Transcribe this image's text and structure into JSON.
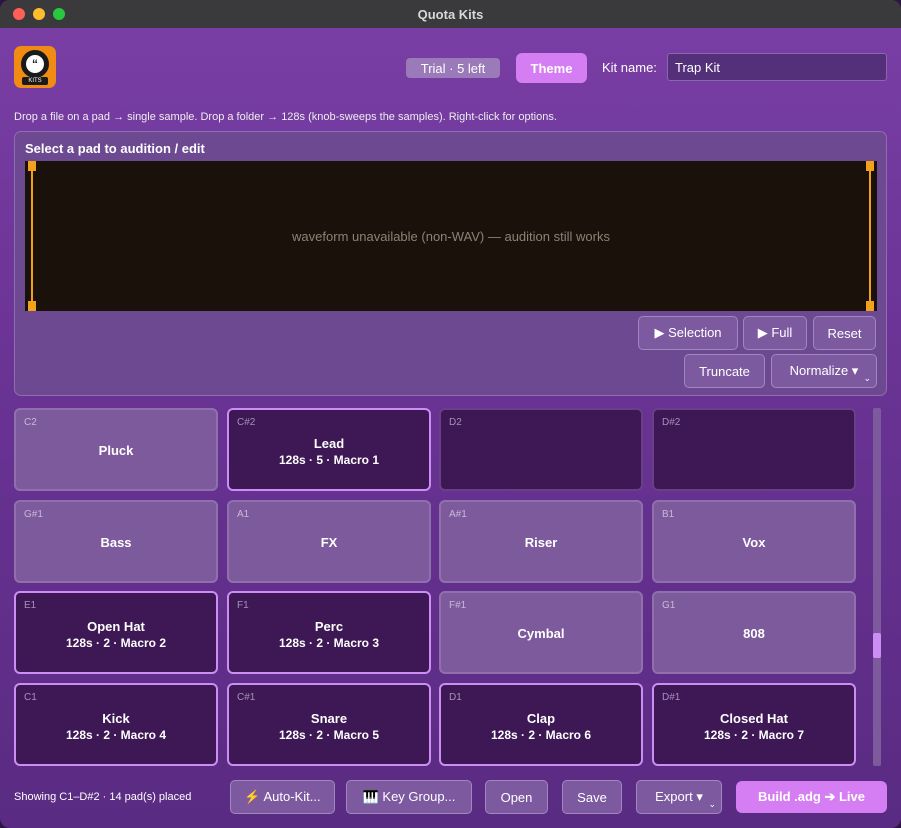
{
  "window": {
    "title": "Quota Kits"
  },
  "header": {
    "logo_text": "KITS",
    "trial_label": "Trial · 5 left",
    "theme_label": "Theme",
    "kit_name_label": "Kit name:",
    "kit_name_value": "Trap Kit"
  },
  "hint": "Drop a file on a pad → single sample.   Drop a folder → 128s (knob-sweeps the samples).   Right-click for options.",
  "editor": {
    "title": "Select a pad to audition / edit",
    "waveform_message": "waveform unavailable (non-WAV) — audition still works",
    "selection_label": "▶ Selection",
    "full_label": "▶ Full",
    "reset_label": "Reset",
    "truncate_label": "Truncate",
    "normalize_label": "Normalize ▾"
  },
  "pads": [
    {
      "note": "C2",
      "name": "Pluck",
      "sub": "",
      "style": "light"
    },
    {
      "note": "C#2",
      "name": "Lead",
      "sub": "128s · 5 · Macro 1",
      "style": "active"
    },
    {
      "note": "D2",
      "name": "",
      "sub": "",
      "style": "dark"
    },
    {
      "note": "D#2",
      "name": "",
      "sub": "",
      "style": "dark"
    },
    {
      "note": "G#1",
      "name": "Bass",
      "sub": "",
      "style": "light"
    },
    {
      "note": "A1",
      "name": "FX",
      "sub": "",
      "style": "light"
    },
    {
      "note": "A#1",
      "name": "Riser",
      "sub": "",
      "style": "light"
    },
    {
      "note": "B1",
      "name": "Vox",
      "sub": "",
      "style": "light"
    },
    {
      "note": "E1",
      "name": "Open Hat",
      "sub": "128s · 2 · Macro 2",
      "style": "active"
    },
    {
      "note": "F1",
      "name": "Perc",
      "sub": "128s · 2 · Macro 3",
      "style": "active"
    },
    {
      "note": "F#1",
      "name": "Cymbal",
      "sub": "",
      "style": "light"
    },
    {
      "note": "G1",
      "name": "808",
      "sub": "",
      "style": "light"
    },
    {
      "note": "C1",
      "name": "Kick",
      "sub": "128s · 2 · Macro 4",
      "style": "active"
    },
    {
      "note": "C#1",
      "name": "Snare",
      "sub": "128s · 2 · Macro 5",
      "style": "active"
    },
    {
      "note": "D1",
      "name": "Clap",
      "sub": "128s · 2 · Macro 6",
      "style": "active"
    },
    {
      "note": "D#1",
      "name": "Closed Hat",
      "sub": "128s · 2 · Macro 7",
      "style": "active"
    }
  ],
  "footer": {
    "status": "Showing C1–D#2   ·   14 pad(s) placed",
    "autokit_label": "⚡ Auto-Kit...",
    "keygroup_label": "🎹 Key Group...",
    "open_label": "Open",
    "save_label": "Save",
    "export_label": "Export ▾",
    "build_label": "Build .adg ➔ Live"
  },
  "colors": {
    "accent": "#d57df2",
    "marker": "#f2a21a",
    "background": "#6b3496"
  }
}
